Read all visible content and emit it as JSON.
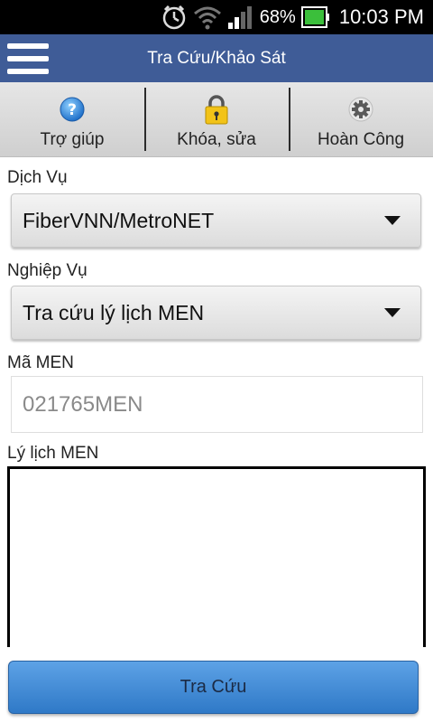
{
  "status_bar": {
    "battery_percent": "68%",
    "time": "10:03 PM",
    "icons": [
      "alarm-icon",
      "wifi-icon",
      "signal-icon",
      "battery-icon"
    ]
  },
  "header": {
    "title": "Tra Cứu/Khảo Sát",
    "menu_icon": "hamburger-menu-icon",
    "color": "#3f5c97"
  },
  "toolbar": {
    "items": [
      {
        "label": "Trợ giúp",
        "icon": "help-icon"
      },
      {
        "label": "Khóa, sửa",
        "icon": "lock-icon"
      },
      {
        "label": "Hoàn Công",
        "icon": "gear-icon"
      }
    ]
  },
  "form": {
    "service_label": "Dịch Vụ",
    "service_value": "FiberVNN/MetroNET",
    "operation_label": "Nghiệp Vụ",
    "operation_value": "Tra cứu lý lịch MEN",
    "men_code_label": "Mã MEN",
    "men_code_value": "021765MEN",
    "history_label": "Lý lịch MEN",
    "history_value": ""
  },
  "submit": {
    "label": "Tra Cứu",
    "color": "#3f86d3"
  }
}
